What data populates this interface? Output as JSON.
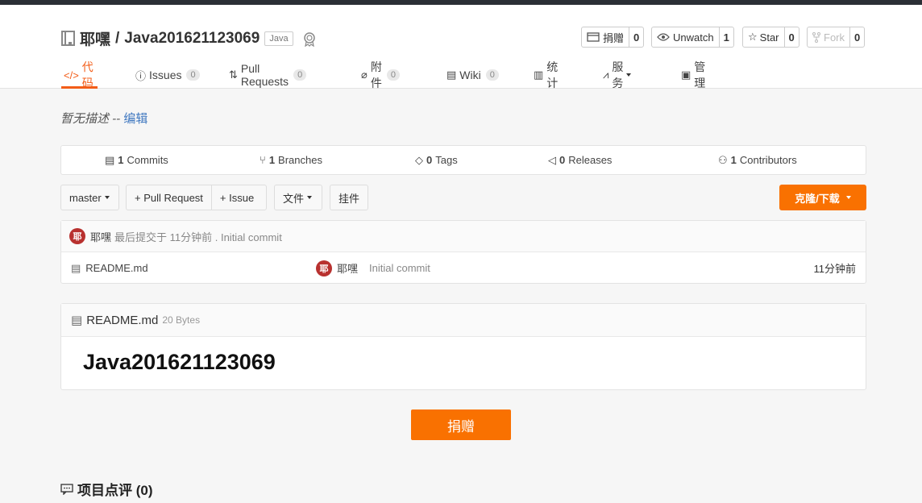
{
  "repo": {
    "owner": "耶嘿",
    "separator": "/",
    "name": "Java201621123069",
    "lang": "Java"
  },
  "actions": [
    {
      "label": "捐赠",
      "count": "0"
    },
    {
      "label": "Unwatch",
      "count": "1"
    },
    {
      "label": "Star",
      "count": "0"
    },
    {
      "label": "Fork",
      "count": "0"
    }
  ],
  "tabs": [
    {
      "label": "代码"
    },
    {
      "label": "Issues",
      "count": "0"
    },
    {
      "label": "Pull Requests",
      "count": "0"
    },
    {
      "label": "附件",
      "count": "0"
    },
    {
      "label": "Wiki",
      "count": "0"
    },
    {
      "label": "统计"
    },
    {
      "label": "服务"
    },
    {
      "label": "管理"
    }
  ],
  "description": {
    "text": "暂无描述",
    "sep": " -- ",
    "edit": "编辑"
  },
  "stats": [
    {
      "num": "1",
      "label": "Commits"
    },
    {
      "num": "1",
      "label": "Branches"
    },
    {
      "num": "0",
      "label": "Tags"
    },
    {
      "num": "0",
      "label": "Releases"
    },
    {
      "num": "1",
      "label": "Contributors"
    }
  ],
  "toolbar": {
    "branch": "master",
    "pull_request": "+ Pull Request",
    "issue": "+ Issue",
    "files": "文件",
    "widget": "挂件",
    "clone": "克隆/下载"
  },
  "last_commit": {
    "avatar": "耶",
    "author": "耶嘿",
    "text": "最后提交于 11分钟前 . Initial commit"
  },
  "files": [
    {
      "name": "README.md",
      "avatar": "耶",
      "author": "耶嘿",
      "message": "Initial commit",
      "time": "11分钟前"
    }
  ],
  "readme": {
    "filename": "README.md",
    "size": "20 Bytes",
    "heading": "Java201621123069"
  },
  "donate_label": "捐赠",
  "comments_title": "项目点评 (0)",
  "colors": {
    "accent": "#f97101",
    "tab_active": "#f35d18",
    "avatar": "#b8312f"
  }
}
